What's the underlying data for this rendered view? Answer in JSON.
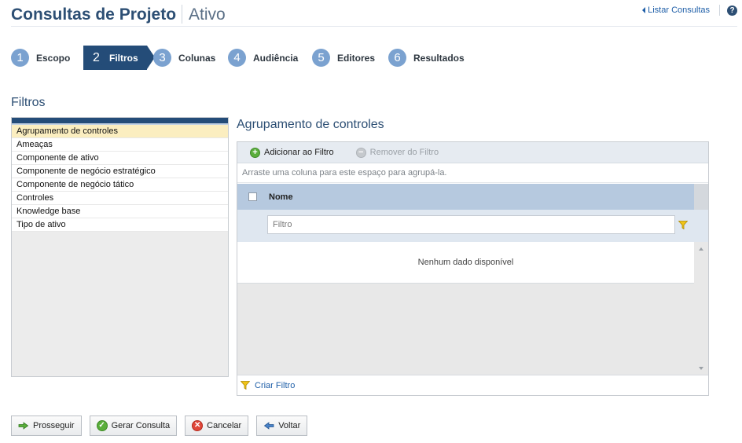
{
  "header": {
    "title": "Consultas de Projeto",
    "subtitle": "Ativo",
    "list_link": "Listar Consultas",
    "help_icon": "?"
  },
  "wizard": {
    "steps": [
      {
        "num": "1",
        "label": "Escopo",
        "active": false
      },
      {
        "num": "2",
        "label": "Filtros",
        "active": true
      },
      {
        "num": "3",
        "label": "Colunas",
        "active": false
      },
      {
        "num": "4",
        "label": "Audiência",
        "active": false
      },
      {
        "num": "5",
        "label": "Editores",
        "active": false
      },
      {
        "num": "6",
        "label": "Resultados",
        "active": false
      }
    ]
  },
  "filters_section": {
    "title": "Filtros",
    "items": [
      "Agrupamento de controles",
      "Ameaças",
      "Componente de ativo",
      "Componente de negócio estratégico",
      "Componente de negócio tático",
      "Controles",
      "Knowledge base",
      "Tipo de ativo"
    ],
    "selected_index": 0
  },
  "detail": {
    "title": "Agrupamento de controles",
    "add_filter": "Adicionar ao Filtro",
    "remove_filter": "Remover do Filtro",
    "group_hint": "Arraste uma coluna para este espaço para agrupá-la.",
    "column_name": "Nome",
    "filter_placeholder": "Filtro",
    "no_data": "Nenhum dado disponível",
    "create_filter": "Criar Filtro"
  },
  "actions": {
    "proceed": "Prosseguir",
    "generate": "Gerar Consulta",
    "cancel": "Cancelar",
    "back": "Voltar"
  },
  "colors": {
    "brand": "#244c78",
    "step_circle": "#7ba2d0",
    "selected_row": "#fbeec0",
    "grid_header": "#b6c9df",
    "link": "#1f5fa8"
  }
}
